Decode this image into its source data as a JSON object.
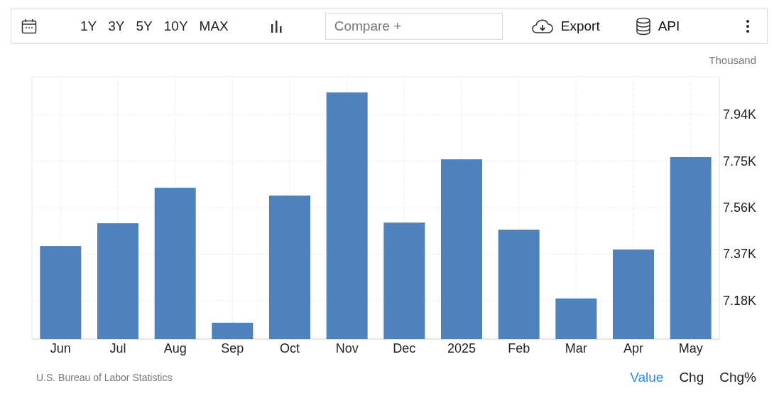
{
  "toolbar": {
    "ranges": [
      {
        "label": "1Y",
        "selected": false
      },
      {
        "label": "3Y",
        "selected": false
      },
      {
        "label": "5Y",
        "selected": false
      },
      {
        "label": "10Y",
        "selected": false
      },
      {
        "label": "MAX",
        "selected": false
      }
    ],
    "compare": {
      "placeholder": "Compare +"
    },
    "export": "Export",
    "api": "API"
  },
  "unit": "Thousand",
  "chart_data": {
    "type": "bar",
    "categories": [
      "Jun",
      "Jul",
      "Aug",
      "Sep",
      "Oct",
      "Nov",
      "Dec",
      "2025",
      "Feb",
      "Mar",
      "Apr",
      "May"
    ],
    "values": [
      7403,
      7496,
      7641,
      7090,
      7609,
      8030,
      7499,
      7757,
      7470,
      7189,
      7389,
      7766
    ],
    "grid": true,
    "ylim": [
      7023,
      8094
    ],
    "yticks": [
      {
        "value": 7180,
        "label": "7.18K"
      },
      {
        "value": 7370,
        "label": "7.37K"
      },
      {
        "value": 7560,
        "label": "7.56K"
      },
      {
        "value": 7750,
        "label": "7.75K"
      },
      {
        "value": 7940,
        "label": "7.94K"
      }
    ]
  },
  "source": "U.S. Bureau of Labor Statistics",
  "views": [
    {
      "label": "Value",
      "selected": true
    },
    {
      "label": "Chg",
      "selected": false
    },
    {
      "label": "Chg%",
      "selected": false
    }
  ]
}
